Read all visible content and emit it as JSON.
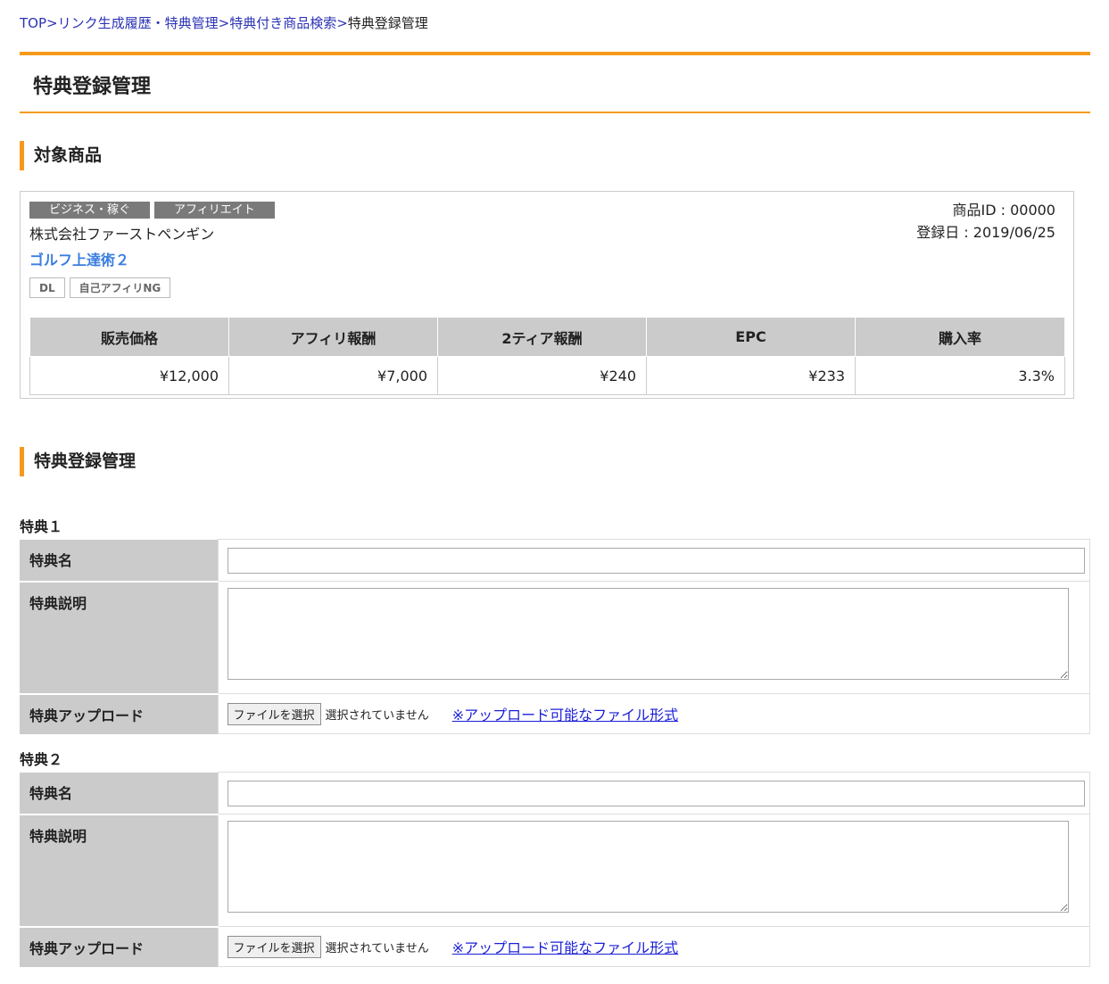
{
  "breadcrumb": {
    "items": [
      "TOP",
      "リンク生成履歴・特典管理",
      "特典付き商品検索"
    ],
    "separator": ">",
    "current": "特典登録管理"
  },
  "page_title": "特典登録管理",
  "product_section": {
    "heading": "対象商品",
    "categories": [
      "ビジネス・稼ぐ",
      "アフィリエイト"
    ],
    "company": "株式会社ファーストペンギン",
    "product_name": "ゴルフ上達術２",
    "tags": [
      "DL",
      "自己アフィリNG"
    ],
    "product_id": "商品ID : 00000",
    "registered_date": "登録日 : 2019/06/25",
    "stats": {
      "headers": [
        "販売価格",
        "アフィリ報酬",
        "2ティア報酬",
        "EPC",
        "購入率"
      ],
      "values": [
        "¥12,000",
        "¥7,000",
        "¥240",
        "¥233",
        "3.3%"
      ]
    }
  },
  "bonus_section": {
    "heading": "特典登録管理",
    "bonuses": [
      {
        "label": "特典１",
        "name_label": "特典名",
        "name_value": "",
        "desc_label": "特典説明",
        "desc_value": "",
        "upload_label": "特典アップロード",
        "file_button": "ファイルを選択",
        "file_status": "選択されていません",
        "format_link": "※アップロード可能なファイル形式"
      },
      {
        "label": "特典２",
        "name_label": "特典名",
        "name_value": "",
        "desc_label": "特典説明",
        "desc_value": "",
        "upload_label": "特典アップロード",
        "file_button": "ファイルを選択",
        "file_status": "選択されていません",
        "format_link": "※アップロード可能なファイル形式"
      }
    ]
  },
  "colors": {
    "accent": "#f59a1c",
    "link": "#2b33b5",
    "product_name": "#3a7de0",
    "table_header_bg": "#cbcbcb",
    "category_bg": "#7a7a7a"
  }
}
